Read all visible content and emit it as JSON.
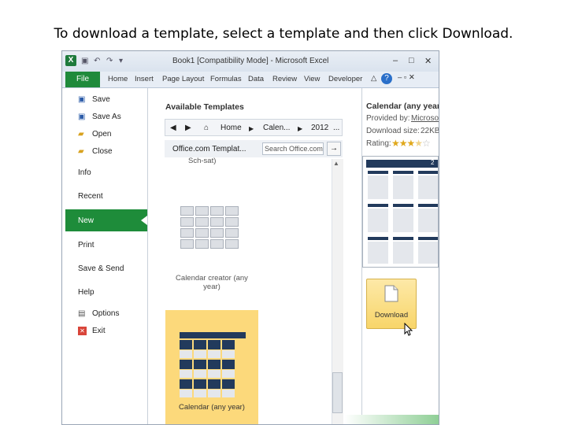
{
  "slide": {
    "title": "To download a template, select a template and then click Download."
  },
  "window": {
    "title": "Book1  [Compatibility Mode]  -  Microsoft Excel",
    "app_icon": "excel-icon",
    "quick_access": [
      "save-icon",
      "undo-icon",
      "redo-icon"
    ],
    "buttons": {
      "minimize": "–",
      "maximize": "□",
      "close": "✕"
    }
  },
  "ribbon": {
    "file_tab": "File",
    "tabs": [
      "Home",
      "Insert",
      "Page Layout",
      "Formulas",
      "Data",
      "Review",
      "View",
      "Developer"
    ],
    "help": "?"
  },
  "backstage": {
    "menu": [
      {
        "label": "Save",
        "icon": "save-icon"
      },
      {
        "label": "Save As",
        "icon": "save-as-icon"
      },
      {
        "label": "Open",
        "icon": "open-folder-icon"
      },
      {
        "label": "Close",
        "icon": "close-folder-icon"
      },
      {
        "label": "Info"
      },
      {
        "label": "Recent"
      },
      {
        "label": "New",
        "selected": true
      },
      {
        "label": "Print"
      },
      {
        "label": "Save & Send"
      },
      {
        "label": "Help"
      },
      {
        "label": "Options",
        "icon": "options-icon"
      },
      {
        "label": "Exit",
        "icon": "exit-icon"
      }
    ]
  },
  "templates": {
    "section_title": "Available Templates",
    "breadcrumb": [
      "Home",
      "Calen...",
      "2012",
      "..."
    ],
    "source_label": "Office.com Templat...",
    "search_placeholder": "Search Office.com",
    "partial_caption": "Sch-sat)",
    "items": [
      {
        "caption": "Calendar creator (any year)"
      },
      {
        "caption": "Calendar (any year)",
        "selected": true
      }
    ]
  },
  "details": {
    "title": "Calendar (any year",
    "provided_label": "Provided by:",
    "provided_value": "Microso",
    "size_label": "Download size:",
    "size_value": "22KB",
    "rating_label": "Rating:",
    "rating": 3.5,
    "rating_max": 5,
    "preview_year": "2",
    "download_label": "Download"
  },
  "colors": {
    "accent_green": "#1e8c3a",
    "selected_tile": "#fcd97b",
    "calendar_header": "#223a5c"
  }
}
